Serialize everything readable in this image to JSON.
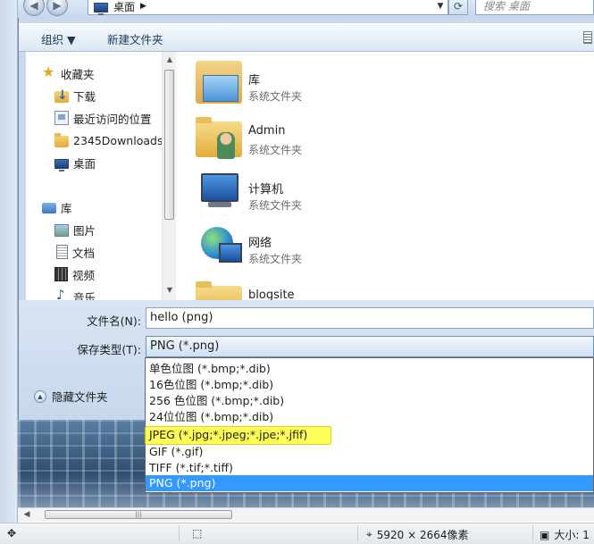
{
  "address": {
    "path_label": "桌面",
    "search_placeholder": "搜索 桌面"
  },
  "toolbar": {
    "organize_label": "组织 ▼",
    "new_folder_label": "新建文件夹"
  },
  "nav_pane": {
    "items": [
      {
        "label": "收藏夹",
        "icon": "star-icon"
      },
      {
        "label": "下载",
        "icon": "download-folder-icon"
      },
      {
        "label": "最近访问的位置",
        "icon": "recent-places-icon"
      },
      {
        "label": "2345Downloads",
        "icon": "folder-icon"
      },
      {
        "label": "桌面",
        "icon": "desktop-icon"
      },
      {
        "label": "库",
        "icon": "library-icon"
      },
      {
        "label": "图片",
        "icon": "pictures-icon"
      },
      {
        "label": "文档",
        "icon": "documents-icon"
      },
      {
        "label": "视频",
        "icon": "videos-icon"
      },
      {
        "label": "音乐",
        "icon": "music-icon"
      }
    ]
  },
  "files": [
    {
      "name": "库",
      "type": "系统文件夹",
      "icon": "library-large-icon"
    },
    {
      "name": "Admin",
      "type": "系统文件夹",
      "icon": "user-folder-icon"
    },
    {
      "name": "计算机",
      "type": "系统文件夹",
      "icon": "computer-icon"
    },
    {
      "name": "网络",
      "type": "系统文件夹",
      "icon": "network-icon"
    },
    {
      "name": "blogsite",
      "type": "",
      "icon": "folder-large-icon"
    }
  ],
  "save_form": {
    "filename_label": "文件名(N):",
    "filename_value": "hello (png)",
    "filetype_label": "保存类型(T):",
    "filetype_value": "PNG (*.png)",
    "hide_folders_label": "隐藏文件夹"
  },
  "filetype_options": [
    "单色位图 (*.bmp;*.dib)",
    "16色位图 (*.bmp;*.dib)",
    "256 色位图 (*.bmp;*.dib)",
    "24位位图 (*.bmp;*.dib)",
    "JPEG (*.jpg;*.jpeg;*.jpe;*.jfif)",
    "GIF (*.gif)",
    "TIFF (*.tif;*.tiff)",
    "PNG (*.png)"
  ],
  "selected_option_index": 7,
  "highlighted_option_index": 4,
  "statusbar": {
    "dimensions": "5920 × 2664像素",
    "size_label": "大小: 1"
  },
  "colors": {
    "selection": "#3399ff",
    "highlight": "#fffd3a"
  }
}
